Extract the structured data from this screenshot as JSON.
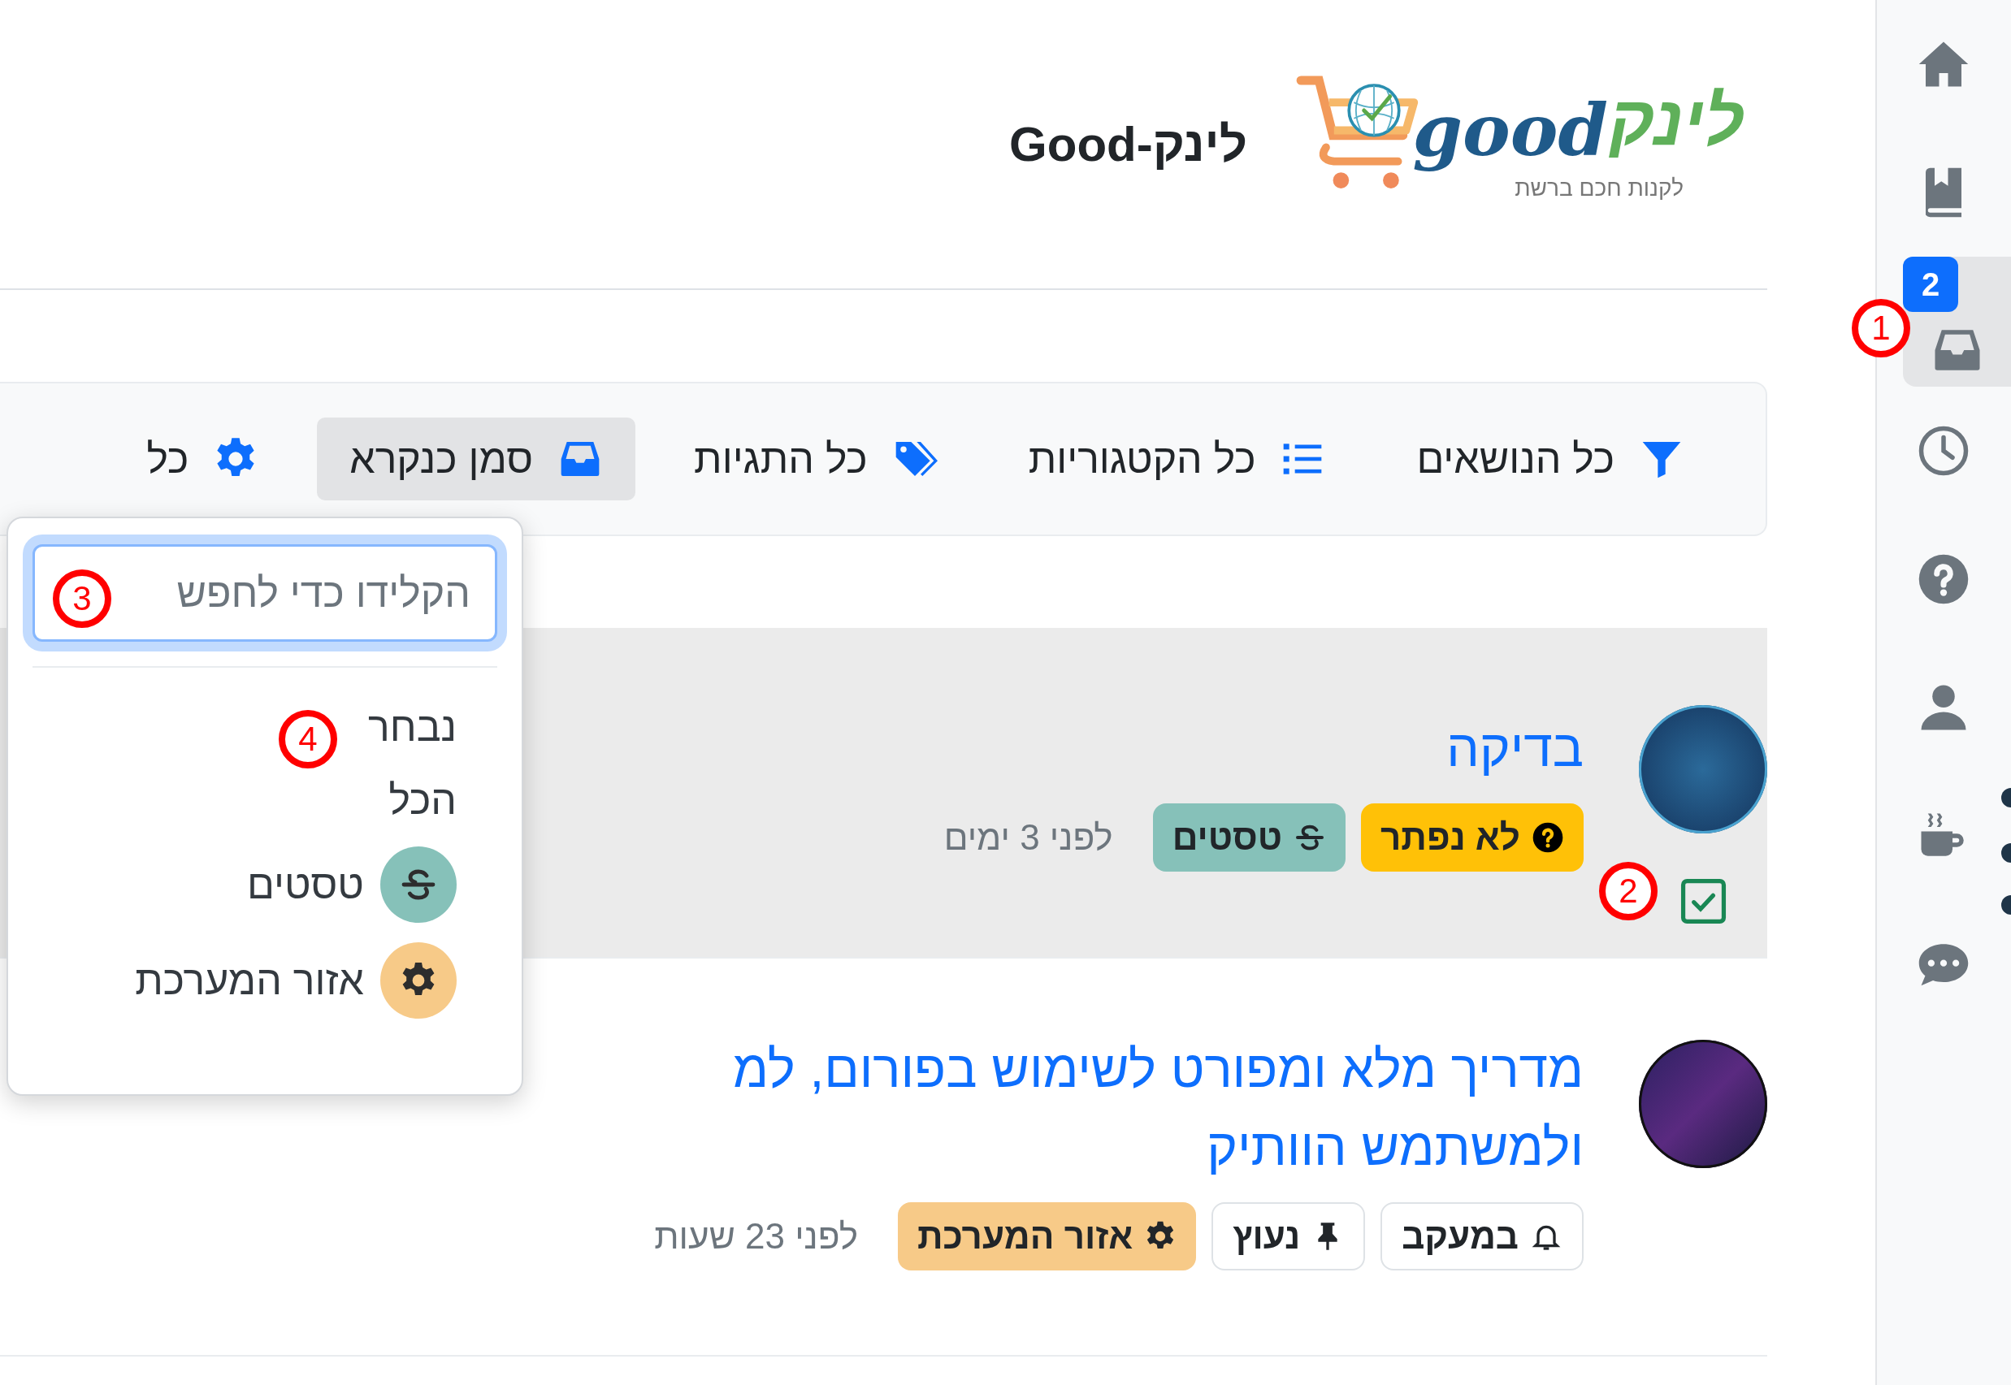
{
  "header": {
    "logo": {
      "brand": "good",
      "brand_hebrew": "לינק",
      "tagline": "לקנות חכם ברשת"
    },
    "title": "לינק-Good"
  },
  "filter_bar": {
    "items": [
      {
        "kind": "funnel",
        "label": "כל הנושאים",
        "selected": false
      },
      {
        "kind": "list",
        "label": "כל הקטגוריות",
        "selected": false
      },
      {
        "kind": "tags",
        "label": "כל התגיות",
        "selected": false
      },
      {
        "kind": "inbox",
        "label": "סמן כנקרא",
        "selected": true
      },
      {
        "kind": "gear",
        "label": "כל",
        "selected": false
      }
    ]
  },
  "dropdown": {
    "search": {
      "placeholder": "הקלידו כדי לחפש"
    },
    "items": [
      {
        "kind": "plain",
        "label": "נבחר"
      },
      {
        "kind": "plain",
        "label": "הכל"
      },
      {
        "kind": "strike",
        "label": "טסטים",
        "color": "#86c1b9"
      },
      {
        "kind": "gear",
        "label": "אזור המערכת",
        "color": "#f7ca88"
      }
    ]
  },
  "topics": [
    {
      "selected": true,
      "title_lines": [
        "בדיקה"
      ],
      "tags": [
        {
          "kind": "question",
          "label": "לא נפתר",
          "color": "#ffc107"
        },
        {
          "kind": "strike",
          "label": "טסטים",
          "color": "#86c1b9"
        }
      ],
      "time": "לפני 3 ימים"
    },
    {
      "selected": false,
      "title_lines": [
        "מדריך מלא ומפורט לשימוש בפורום, למ",
        "ולמשתמש הוותיק"
      ],
      "tags": [
        {
          "kind": "bell",
          "label": "במעקב"
        },
        {
          "kind": "pin",
          "label": "נעוץ"
        },
        {
          "kind": "gear",
          "label": "אזור המערכת",
          "color": "#f7ca88"
        }
      ],
      "time": "לפני 23 שעות"
    }
  ],
  "sidebar": {
    "items": [
      {
        "kind": "home",
        "selected": false
      },
      {
        "kind": "book",
        "selected": false
      },
      {
        "kind": "inbox",
        "selected": true,
        "badge": "2"
      },
      {
        "kind": "clock",
        "selected": false
      },
      {
        "kind": "question",
        "selected": false
      },
      {
        "kind": "user",
        "selected": false
      },
      {
        "kind": "coffee",
        "selected": false
      },
      {
        "kind": "chat",
        "selected": false
      }
    ]
  },
  "annotations": [
    {
      "number": "1"
    },
    {
      "number": "2"
    },
    {
      "number": "3"
    },
    {
      "number": "4"
    }
  ]
}
